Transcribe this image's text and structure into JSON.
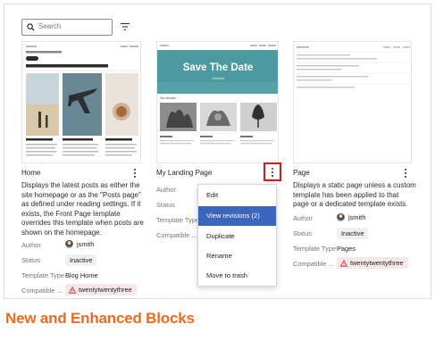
{
  "search": {
    "placeholder": "Search"
  },
  "cards": [
    {
      "title": "Home",
      "description": "Displays the latest posts as either the site homepage or as the \"Posts page\" as defined under reading settings. If it exists, the Front Page template overrides this template when posts are shown on the homepage.",
      "author_label": "Author",
      "author_value": "jsmith",
      "status_label": "Status",
      "status_value": "Inactive",
      "template_type_label": "Template Type",
      "template_type_value": "Blog Home",
      "compatible_label": "Compatible ...",
      "compatible_value": "twentytwentythree",
      "thumb": {
        "small_nav": "Save",
        "headline": "Mindblown: a blog about philosophy.",
        "badge": "Latest",
        "post_titles": [
          "Hello world",
          "Meaning of life",
          "Morning coffee"
        ]
      }
    },
    {
      "title": "My Landing Page",
      "author_label": "Author",
      "status_label": "Status",
      "template_type_label": "Template Type",
      "compatible_label": "Compatible ...",
      "thumb": {
        "small_nav": "Save",
        "headline": "Save The Date",
        "subtitle": "Celebrate",
        "section": "Our services"
      }
    },
    {
      "title": "Page",
      "description": "Displays a static page unless a custom template has been applied to that page or a dedicated template exists.",
      "author_label": "Author",
      "author_value": "jsmith",
      "status_label": "Status",
      "status_value": "Inactive",
      "template_type_label": "Template Type",
      "template_type_value": "Pages",
      "compatible_label": "Compatible ...",
      "compatible_value": "twentytwentythree"
    }
  ],
  "menu": {
    "items": [
      "Edit",
      "View revisions (2)",
      "Duplicate",
      "Rename",
      "Move to trash"
    ],
    "active_index": 1
  },
  "heading": "New and Enhanced Blocks",
  "colors": {
    "accent": "#3a66bd",
    "heading": "#f06a1e",
    "highlight_border": "#e0141e",
    "warn_pill": "#f6e8e8",
    "teal_hero": "#4c9aa0"
  }
}
